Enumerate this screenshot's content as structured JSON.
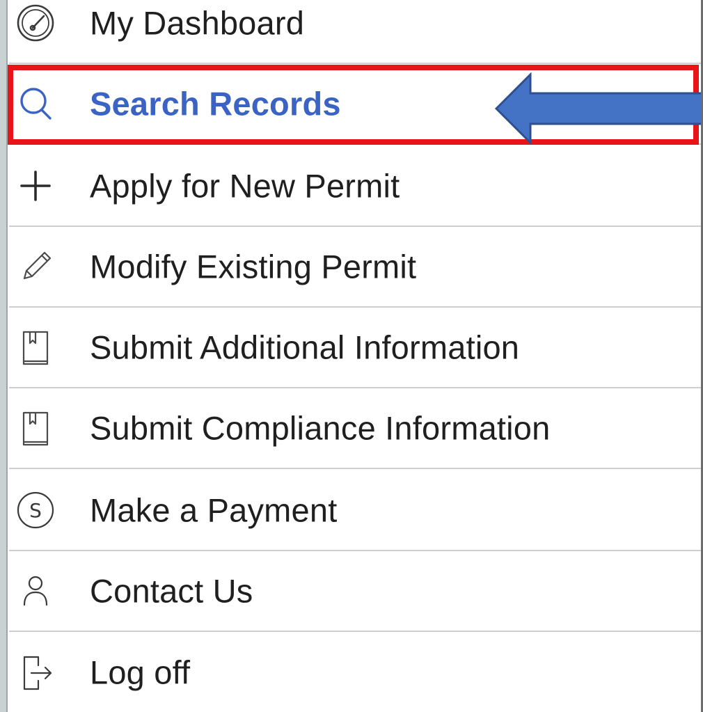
{
  "menu": {
    "items": [
      {
        "label": "My Dashboard",
        "icon": "dashboard-gauge-icon"
      },
      {
        "label": "Search Records",
        "icon": "search-icon",
        "active": true
      },
      {
        "label": "Apply for New Permit",
        "icon": "plus-icon"
      },
      {
        "label": "Modify Existing Permit",
        "icon": "pencil-icon"
      },
      {
        "label": "Submit Additional Information",
        "icon": "book-icon"
      },
      {
        "label": "Submit Compliance Information",
        "icon": "book-icon"
      },
      {
        "label": "Make a Payment",
        "icon": "dollar-circle-icon"
      },
      {
        "label": "Contact Us",
        "icon": "person-icon"
      },
      {
        "label": "Log off",
        "icon": "logout-icon"
      }
    ]
  },
  "annotation": {
    "highlight_color": "#e8141a",
    "arrow_color": "#4472c4",
    "arrow_outline_color": "#2f4f8f"
  },
  "colors": {
    "active_text": "#3b63c4",
    "text": "#1f1f1f",
    "divider": "#cfcfcf"
  }
}
